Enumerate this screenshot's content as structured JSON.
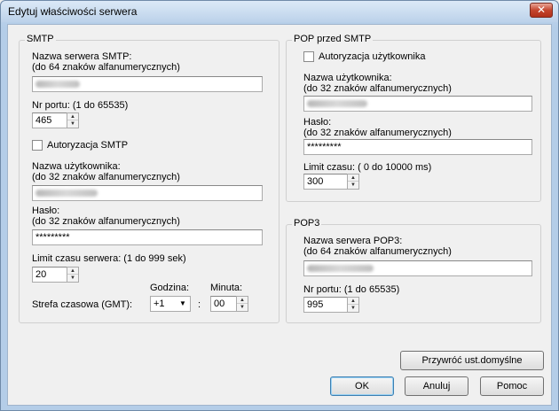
{
  "window": {
    "title": "Edytuj właściwości serwera",
    "close_glyph": "✕"
  },
  "smtp": {
    "legend": "SMTP",
    "server_label": "Nazwa serwera SMTP:",
    "server_hint": "(do 64 znaków alfanumerycznych)",
    "port_label": "Nr portu: (1 do 65535)",
    "port_value": "465",
    "auth_label": "Autoryzacja SMTP",
    "user_label": "Nazwa użytkownika:",
    "user_hint": "(do 32 znaków alfanumerycznych)",
    "pass_label": "Hasło:",
    "pass_hint": "(do 32 znaków alfanumerycznych)",
    "pass_value": "*********",
    "timeout_label": "Limit czasu serwera: (1 do 999 sek)",
    "timeout_value": "20",
    "tz_label": "Strefa czasowa (GMT):",
    "hour_label": "Godzina:",
    "hour_value": "+1",
    "colon": ":",
    "minute_label": "Minuta:",
    "minute_value": "00"
  },
  "pop_before": {
    "legend": "POP przed SMTP",
    "auth_label": "Autoryzacja użytkownika",
    "user_label": "Nazwa użytkownika:",
    "user_hint": "(do 32 znaków alfanumerycznych)",
    "pass_label": "Hasło:",
    "pass_hint": "(do 32 znaków alfanumerycznych)",
    "pass_value": "*********",
    "timeout_label": "Limit czasu: ( 0 do 10000 ms)",
    "timeout_value": "300"
  },
  "pop3": {
    "legend": "POP3",
    "server_label": "Nazwa serwera POP3:",
    "server_hint": "(do 64 znaków alfanumerycznych)",
    "port_label": "Nr portu: (1 do 65535)",
    "port_value": "995"
  },
  "buttons": {
    "defaults": "Przywróć ust.domyślne",
    "ok": "OK",
    "cancel": "Anuluj",
    "help": "Pomoc"
  }
}
